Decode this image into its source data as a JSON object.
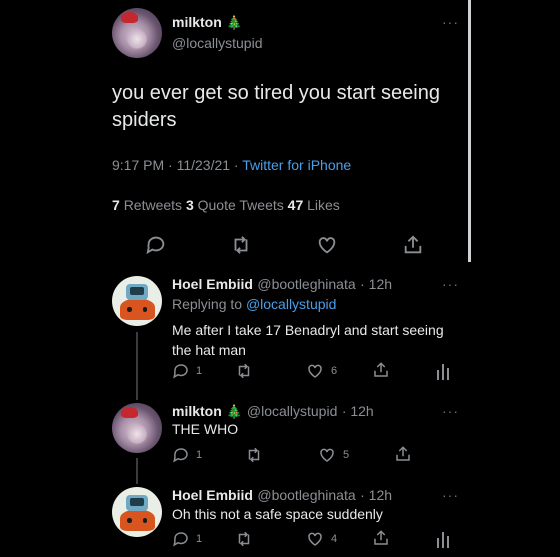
{
  "main_tweet": {
    "name": "milkton",
    "emoji": "🎄",
    "handle": "@locallystupid",
    "text_line1": "you ever get so tired you start seeing",
    "text_line2": "spiders",
    "time": "9:17 PM · 11/23/21 · ",
    "source": "Twitter for iPhone",
    "retweets_count": "7",
    "retweets_label": "Retweets",
    "quotes_count": "3",
    "quotes_label": "Quote Tweets",
    "likes_count": "47",
    "likes_label": "Likes"
  },
  "replies": [
    {
      "name": "Hoel Embiid",
      "handle": "@bootleghinata",
      "time": "· 12h",
      "replying_prefix": "Replying to",
      "replying_to": "@locallystupid",
      "text_line1": "Me after I take 17 Benadryl and start seeing",
      "text_line2": "the hat man",
      "reply_count": "1",
      "like_count": "6"
    },
    {
      "name": "milkton",
      "emoji": "🎄",
      "handle": "@locallystupid",
      "time": "· 12h",
      "text_line1": "THE WHO",
      "reply_count": "1",
      "like_count": "5"
    },
    {
      "name": "Hoel Embiid",
      "handle": "@bootleghinata",
      "time": "· 12h",
      "text_line1": "Oh this not a safe space suddenly",
      "reply_count": "1",
      "like_count": "4"
    }
  ],
  "more_label": "···",
  "colors": {
    "background": "#000000",
    "accent": "#4a9fe8",
    "muted": "#8b8f94"
  }
}
